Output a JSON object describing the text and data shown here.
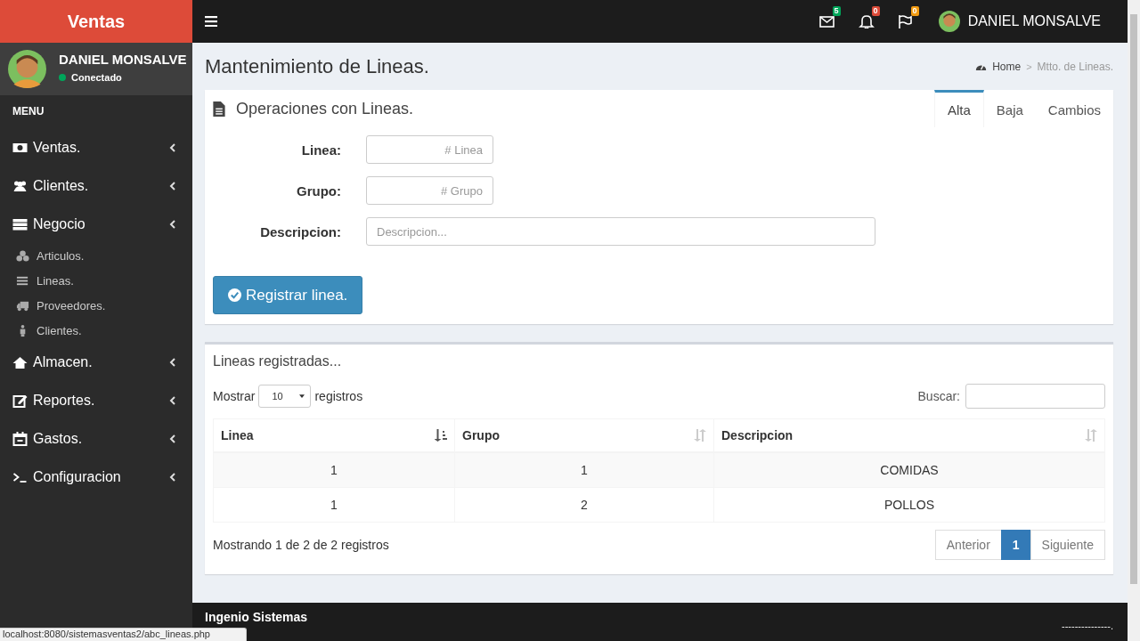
{
  "brand": "Ventas",
  "user": {
    "name": "DANIEL MONSALVE",
    "status": {
      "label": "Conectado",
      "color": "#00a65a"
    }
  },
  "sidebar": {
    "header": "MENU",
    "items": [
      {
        "label": "Ventas."
      },
      {
        "label": "Clientes."
      },
      {
        "label": "Negocio",
        "children": [
          {
            "label": "Articulos."
          },
          {
            "label": "Lineas."
          },
          {
            "label": "Proveedores."
          },
          {
            "label": "Clientes."
          }
        ]
      },
      {
        "label": "Almacen."
      },
      {
        "label": "Reportes."
      },
      {
        "label": "Gastos."
      },
      {
        "label": "Configuracion"
      }
    ]
  },
  "topbar": {
    "notifications": [
      {
        "count": "5",
        "color": "#00a65a"
      },
      {
        "count": "0",
        "color": "#dd4b39"
      },
      {
        "count": "0",
        "color": "#f39c12"
      }
    ],
    "user_name": "DANIEL MONSALVE"
  },
  "page": {
    "title": "Mantenimiento de Lineas.",
    "breadcrumb": [
      "Home",
      "Mtto. de Lineas."
    ],
    "breadcrumb_separator": ">"
  },
  "form_box": {
    "title": "Operaciones con Lineas.",
    "tabs": [
      {
        "label": "Alta",
        "selected": true
      },
      {
        "label": "Baja",
        "selected": false
      },
      {
        "label": "Cambios",
        "selected": false
      }
    ],
    "fields": [
      {
        "label": "Linea:",
        "placeholder": "# Linea",
        "kind": "short"
      },
      {
        "label": "Grupo:",
        "placeholder": "# Grupo",
        "kind": "short"
      },
      {
        "label": "Descripcion:",
        "placeholder": "Descripcion...",
        "kind": "wide"
      }
    ],
    "submit": "Registrar linea."
  },
  "table_box": {
    "title": "Lineas registradas...",
    "show_label": "Mostrar",
    "page_size": "10",
    "records_label": "registros",
    "search_label": "Buscar:",
    "columns": [
      {
        "label": "Linea",
        "sorted": true
      },
      {
        "label": "Grupo",
        "sorted": false
      },
      {
        "label": "Descripcion",
        "sorted": false
      }
    ],
    "rows": [
      [
        "1",
        "1",
        "COMIDAS"
      ],
      [
        "1",
        "2",
        "POLLOS"
      ]
    ],
    "info": "Mostrando 1 de 2 de 2 registros",
    "pagination": [
      {
        "label": "Anterior",
        "selected": false
      },
      {
        "label": "1",
        "selected": true
      },
      {
        "label": "Siguiente",
        "selected": false
      }
    ]
  },
  "footer": {
    "left": "Ingenio Sistemas",
    "right": "---------------."
  },
  "status_url": "localhost:8080/sistemasventas2/abc_lineas.php"
}
